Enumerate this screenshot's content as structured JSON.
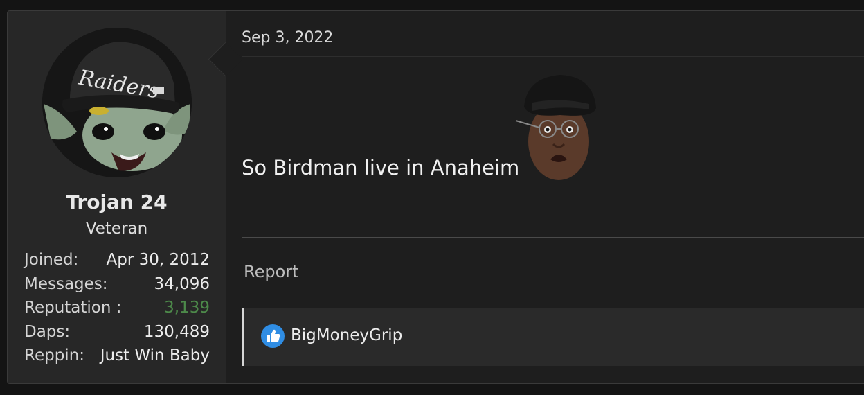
{
  "post": {
    "date": "Sep 3, 2022",
    "message": "So Birdman live in Anaheim",
    "smiley": "birdman-smiley-icon",
    "report_label": "Report"
  },
  "user": {
    "name": "Trojan 24",
    "title": "Veteran",
    "avatar": "avatar-baby-yoda-raiders-cap",
    "stats": [
      {
        "label": "Joined:",
        "value": "Apr 30, 2012"
      },
      {
        "label": "Messages:",
        "value": "34,096"
      },
      {
        "label": "Reputation :",
        "value": "3,139"
      },
      {
        "label": "Daps:",
        "value": "130,489"
      },
      {
        "label": "Reppin:",
        "value": "Just Win Baby"
      }
    ]
  },
  "reactions": {
    "icon": "like-icon",
    "users": "BigMoneyGrip"
  },
  "colors": {
    "background": "#141414",
    "post_bg": "#1e1e1e",
    "sidebar_bg": "#272727",
    "reputation_positive": "#4d8a4a",
    "like_blue": "#2f8de4"
  }
}
